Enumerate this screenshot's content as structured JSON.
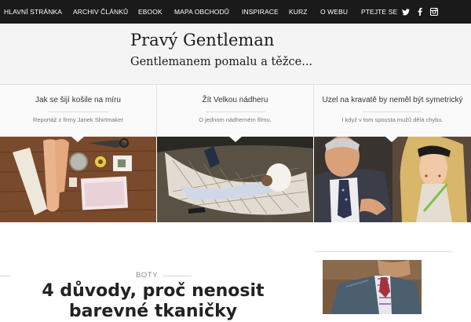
{
  "nav": {
    "items": [
      "HLAVNÍ STRÁNKA",
      "ARCHIV ČLÁNKŮ",
      "EBOOK",
      "MAPA OBCHODŮ",
      "INSPIRACE",
      "KURZ",
      "O WEBU",
      "PTEJTE SE"
    ],
    "social_icons": [
      "twitter-icon",
      "facebook-icon",
      "instagram-icon"
    ]
  },
  "header": {
    "title": "Pravý Gentleman",
    "tagline": "Gentlemanem pomalu a těžce..."
  },
  "features": [
    {
      "title": "Jak se šijí košile na míru",
      "subtitle": "Reportáž z firmy Janek Shirtmaker"
    },
    {
      "title": "Žít Velkou nádheru",
      "subtitle": "O jednom nádherném filmu."
    },
    {
      "title": "Uzel na kravatě by neměl být symetrický",
      "subtitle": "I když v tom spousta mužů dělá chybu."
    }
  ],
  "post": {
    "category": "BOTY",
    "title": "4 důvody, proč nenosit barevné tkaničky"
  },
  "colors": {
    "nav_bg": "#1a1a1a",
    "header_bg": "#f4f4f4",
    "text": "#222222"
  }
}
